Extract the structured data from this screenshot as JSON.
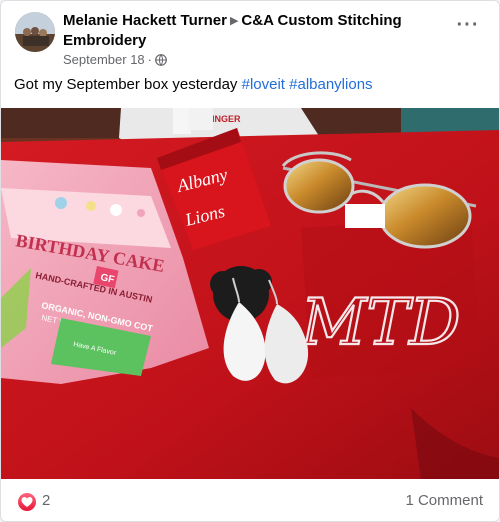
{
  "post": {
    "author": "Melanie Hackett Turner",
    "group": "C&A Custom Stitching Embroidery",
    "date": "September 18",
    "dot": "·",
    "privacy_icon": "globe-icon",
    "menu_icon": "more-options-icon",
    "caption_text": "Got my September box yesterday ",
    "hashtags": [
      "#loveit",
      "#albanylions"
    ]
  },
  "photo": {
    "candy_bag": {
      "title": "BIRTHDAY CAKE",
      "line1": "HAND-CRAFTED IN AUSTIN",
      "badge": "GF",
      "line2": "ORGANIC, NON-GMO COT",
      "line3": "NET WT. 5.1 OZ (144G)",
      "sticker": "Have A Flavor"
    },
    "cowbell_text": [
      "Albany",
      "Lions"
    ],
    "monogram": "MTD",
    "brand": "SINGER"
  },
  "reactions": {
    "icon": "heart-reaction-icon",
    "count": "2"
  },
  "comments": {
    "label": "1 Comment"
  },
  "colors": {
    "link": "#216fdb",
    "reaction": "#e61739",
    "shirt_red": "#c8121b"
  }
}
